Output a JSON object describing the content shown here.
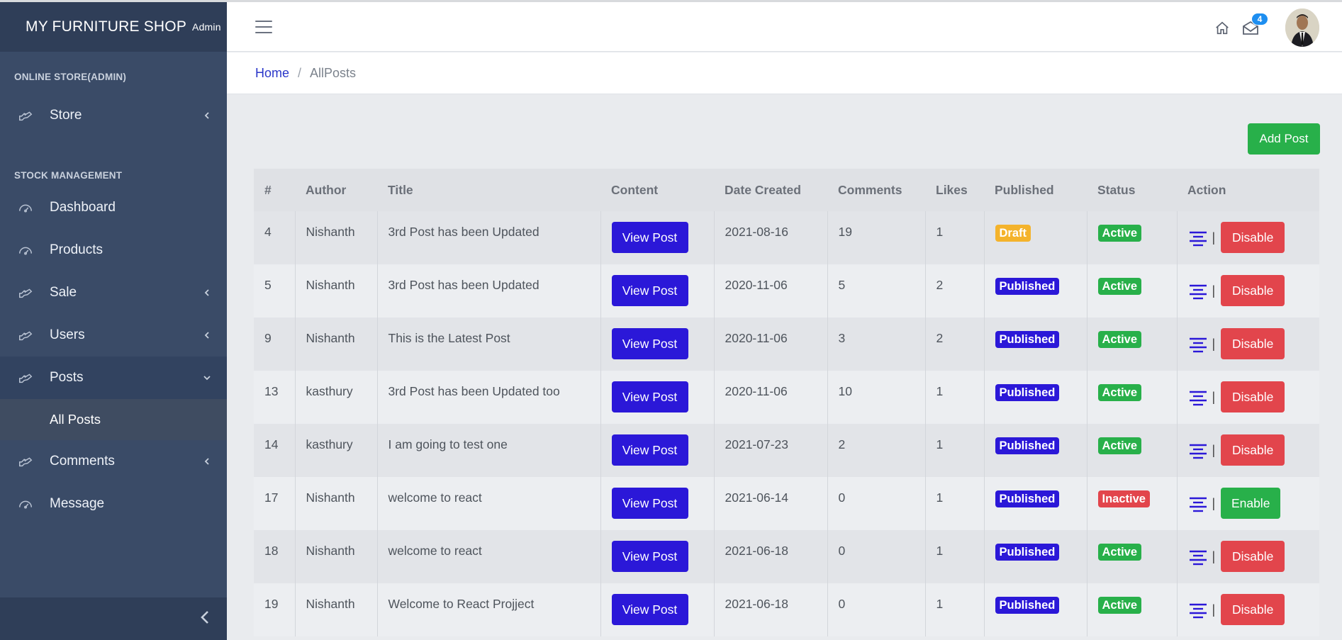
{
  "app": {
    "brand_name": "MY FURNITURE SHOP",
    "brand_sub": "Admin"
  },
  "sidebar": {
    "sections": [
      {
        "title": "ONLINE STORE(ADMIN)",
        "items": [
          {
            "label": "Store",
            "icon": "hand-icon",
            "chevron": "left"
          }
        ]
      },
      {
        "title": "STOCK MANAGEMENT",
        "items": [
          {
            "label": "Dashboard",
            "icon": "gauge-icon"
          },
          {
            "label": "Products",
            "icon": "gauge-icon"
          },
          {
            "label": "Sale",
            "icon": "hand-icon",
            "chevron": "left"
          },
          {
            "label": "Users",
            "icon": "hand-icon",
            "chevron": "left"
          },
          {
            "label": "Posts",
            "icon": "hand-icon",
            "chevron": "down",
            "open": true
          },
          {
            "label": "Comments",
            "icon": "hand-icon",
            "chevron": "left"
          },
          {
            "label": "Message",
            "icon": "gauge-icon"
          }
        ]
      }
    ],
    "sub_items": {
      "posts": [
        "All Posts"
      ]
    }
  },
  "header": {
    "mail_count": "4"
  },
  "breadcrumb": {
    "home": "Home",
    "current": "AllPosts"
  },
  "toolbar": {
    "add_label": "Add Post"
  },
  "table": {
    "columns": [
      "#",
      "Author",
      "Title",
      "Content",
      "Date Created",
      "Comments",
      "Likes",
      "Published",
      "Status",
      "Action"
    ],
    "view_label": "View Post",
    "rows": [
      {
        "id": "4",
        "author": "Nishanth",
        "title": "3rd Post has been Updated",
        "date": "2021-08-16",
        "comments": "19",
        "likes": "1",
        "published": "Draft",
        "status": "Active",
        "action": "Disable"
      },
      {
        "id": "5",
        "author": "Nishanth",
        "title": "3rd Post has been Updated",
        "date": "2020-11-06",
        "comments": "5",
        "likes": "2",
        "published": "Published",
        "status": "Active",
        "action": "Disable"
      },
      {
        "id": "9",
        "author": "Nishanth",
        "title": "This is the Latest Post",
        "date": "2020-11-06",
        "comments": "3",
        "likes": "2",
        "published": "Published",
        "status": "Active",
        "action": "Disable"
      },
      {
        "id": "13",
        "author": "kasthury",
        "title": "3rd Post has been Updated too",
        "date": "2020-11-06",
        "comments": "10",
        "likes": "1",
        "published": "Published",
        "status": "Active",
        "action": "Disable"
      },
      {
        "id": "14",
        "author": "kasthury",
        "title": "I am going to test one",
        "date": "2021-07-23",
        "comments": "2",
        "likes": "1",
        "published": "Published",
        "status": "Active",
        "action": "Disable"
      },
      {
        "id": "17",
        "author": "Nishanth",
        "title": "welcome to react",
        "date": "2021-06-14",
        "comments": "0",
        "likes": "1",
        "published": "Published",
        "status": "Inactive",
        "action": "Enable"
      },
      {
        "id": "18",
        "author": "Nishanth",
        "title": "welcome to react",
        "date": "2021-06-18",
        "comments": "0",
        "likes": "1",
        "published": "Published",
        "status": "Active",
        "action": "Disable"
      },
      {
        "id": "19",
        "author": "Nishanth",
        "title": "Welcome to React Projject",
        "date": "2021-06-18",
        "comments": "0",
        "likes": "1",
        "published": "Published",
        "status": "Active",
        "action": "Disable"
      }
    ]
  },
  "colors": {
    "sidebar_bg": "#3a4b67",
    "brand_bg": "#2f3e58",
    "primary": "#2b18d8",
    "success": "#28b04a",
    "danger": "#e2454c",
    "warning": "#f4b32c",
    "badge_info": "#1d8ef0"
  }
}
